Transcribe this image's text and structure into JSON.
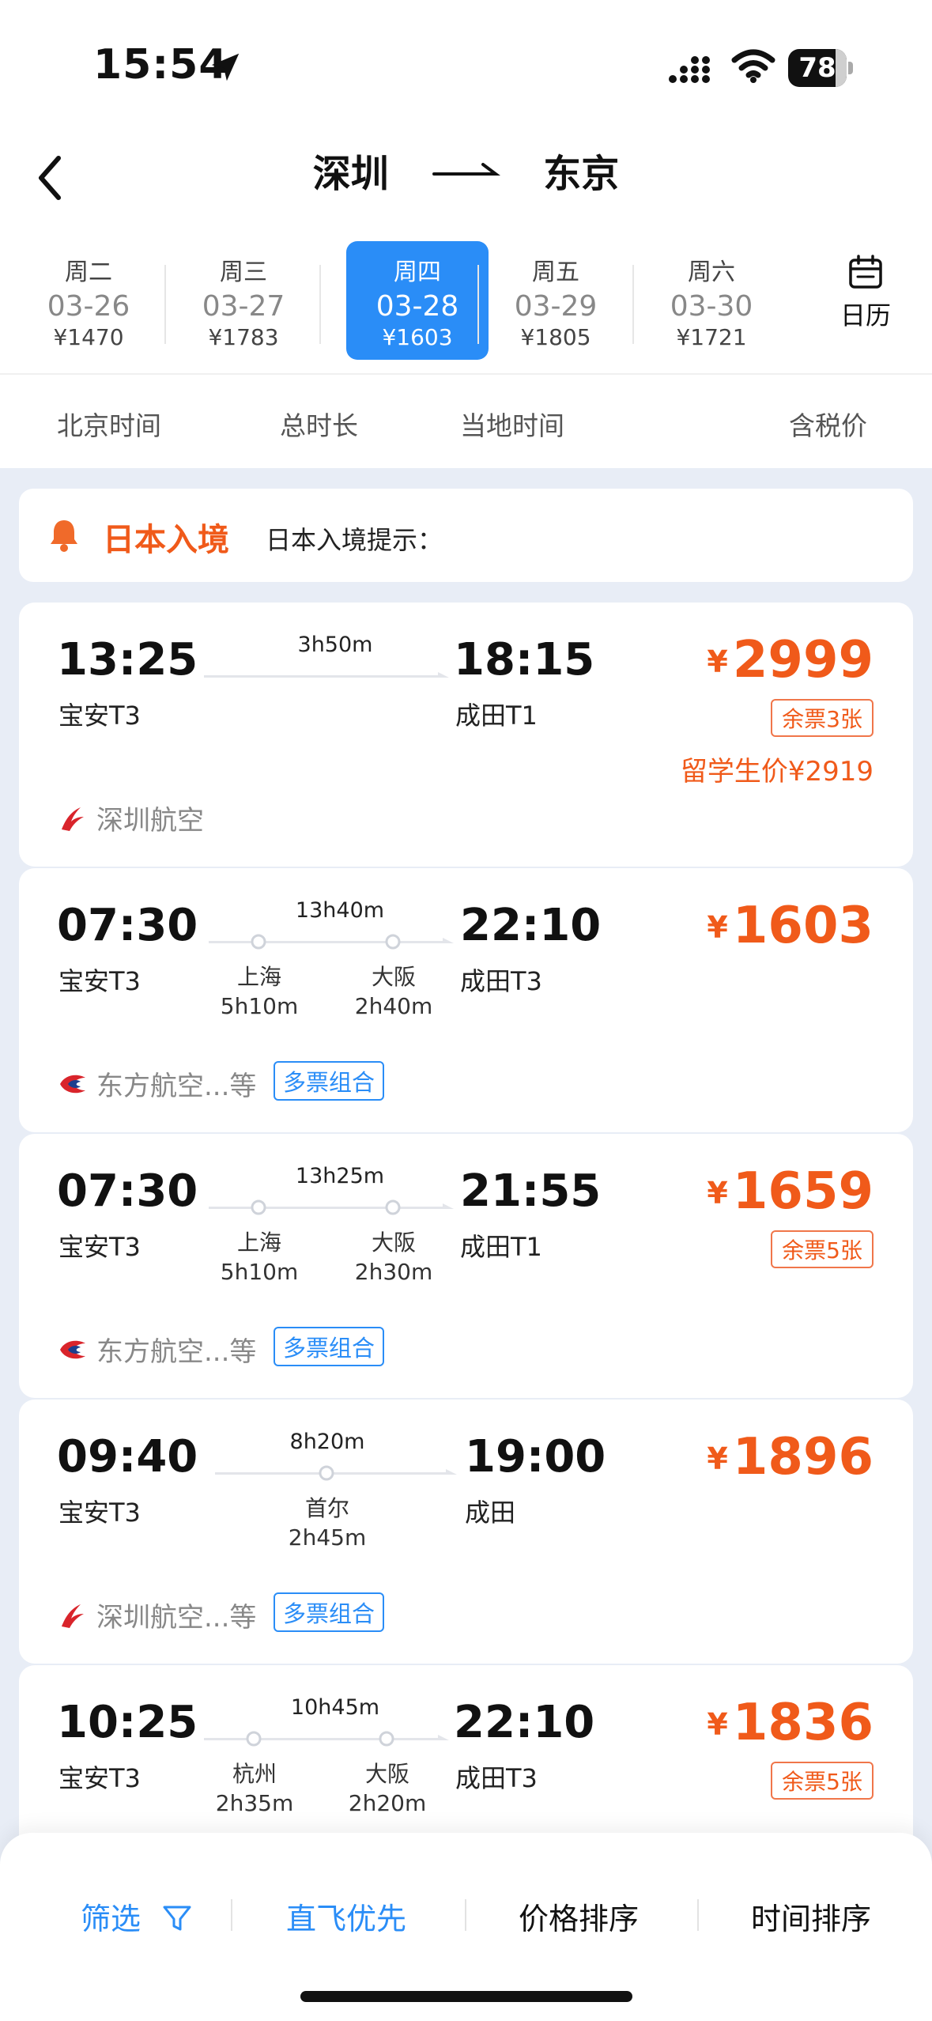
{
  "status": {
    "time": "15:54",
    "battery": "78"
  },
  "header": {
    "from": "深圳",
    "to": "东京"
  },
  "dates": [
    {
      "dow": "周二",
      "md": "03-26",
      "price": "¥1470"
    },
    {
      "dow": "周三",
      "md": "03-27",
      "price": "¥1783"
    },
    {
      "dow": "周四",
      "md": "03-28",
      "price": "¥1603"
    },
    {
      "dow": "周五",
      "md": "03-29",
      "price": "¥1805"
    },
    {
      "dow": "周六",
      "md": "03-30",
      "price": "¥1721"
    }
  ],
  "calendar_label": "日历",
  "sortbar": {
    "beijing_time": "北京时间",
    "total_duration": "总时长",
    "local_time": "当地时间",
    "tax_included": "含税价"
  },
  "notice": {
    "title": "日本入境",
    "text": "日本入境提示："
  },
  "flights": [
    {
      "dep": "13:25",
      "dep_ap": "宝安T3",
      "dur": "3h50m",
      "arr": "18:15",
      "arr_ap": "成田T1",
      "yen": "¥",
      "price": "2999",
      "tag": "余票3张",
      "student": "留学生价¥2919",
      "airline": "深圳航空"
    },
    {
      "dep": "07:30",
      "dep_ap": "宝安T3",
      "dur": "13h40m",
      "stop1": "上海",
      "stop1_t": "5h10m",
      "stop2": "大阪",
      "stop2_t": "2h40m",
      "arr": "22:10",
      "arr_ap": "成田T3",
      "yen": "¥",
      "price": "1603",
      "airline": "东方航空...等",
      "combo": "多票组合"
    },
    {
      "dep": "07:30",
      "dep_ap": "宝安T3",
      "dur": "13h25m",
      "stop1": "上海",
      "stop1_t": "5h10m",
      "stop2": "大阪",
      "stop2_t": "2h30m",
      "arr": "21:55",
      "arr_ap": "成田T1",
      "yen": "¥",
      "price": "1659",
      "tag": "余票5张",
      "airline": "东方航空...等",
      "combo": "多票组合"
    },
    {
      "dep": "09:40",
      "dep_ap": "宝安T3",
      "dur": "8h20m",
      "stop1": "首尔",
      "stop1_t": "2h45m",
      "arr": "19:00",
      "arr_ap": "成田",
      "yen": "¥",
      "price": "1896",
      "airline": "深圳航空...等",
      "combo": "多票组合"
    },
    {
      "dep": "10:25",
      "dep_ap": "宝安T3",
      "dur": "10h45m",
      "stop1": "杭州",
      "stop1_t": "2h35m",
      "stop2": "大阪",
      "stop2_t": "2h20m",
      "arr": "22:10",
      "arr_ap": "成田T3",
      "yen": "¥",
      "price": "1836",
      "tag": "余票5张"
    }
  ],
  "bottom": {
    "filter": "筛选",
    "direct_first": "直飞优先",
    "price_sort": "价格排序",
    "time_sort": "时间排序"
  },
  "colors": {
    "accent_blue": "#2a8df7",
    "price_orange": "#f05a1a"
  }
}
